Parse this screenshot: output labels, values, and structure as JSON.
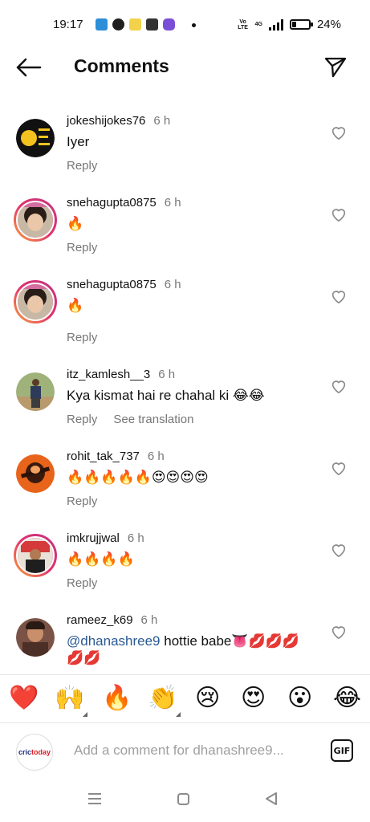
{
  "status_bar": {
    "time": "19:17",
    "network": "4G",
    "volte": "Vo LTE",
    "battery": "24%",
    "battery_level": 0.24
  },
  "header": {
    "title": "Comments"
  },
  "comments": [
    {
      "username": "jokeshijokes76",
      "time": "6 h",
      "text": "Iyer",
      "reply": "Reply"
    },
    {
      "username": "snehagupta0875",
      "time": "6 h",
      "text": "🔥",
      "reply": "Reply"
    },
    {
      "username": "snehagupta0875",
      "time": "6 h",
      "text": "🔥",
      "reply": "Reply"
    },
    {
      "username": "itz_kamlesh__3",
      "time": "6 h",
      "text": "Kya kismat hai re chahal ki 😂😂",
      "reply": "Reply",
      "translate": "See translation"
    },
    {
      "username": "rohit_tak_737",
      "time": "6 h",
      "text": "🔥🔥🔥🔥🔥😍😍😍😍",
      "reply": "Reply"
    },
    {
      "username": "imkrujjwal",
      "time": "6 h",
      "text": "🔥🔥🔥🔥",
      "reply": "Reply"
    },
    {
      "username": "rameez_k69",
      "time": "6 h",
      "mention": "@dhanashree9",
      "text": " hottie babe👅💋💋💋",
      "text_line2": "💋💋"
    }
  ],
  "reactions": [
    "❤️",
    "🙌",
    "🔥",
    "👏",
    "😢",
    "😍",
    "😮",
    "😂"
  ],
  "composer": {
    "avatar_text_a": "cric",
    "avatar_text_b": "today",
    "placeholder": "Add a comment for dhanashree9...",
    "gif_label": "GIF"
  },
  "colors": {
    "accent": "#2a5a93",
    "muted": "#777777",
    "story_ring": "#e1306c"
  }
}
